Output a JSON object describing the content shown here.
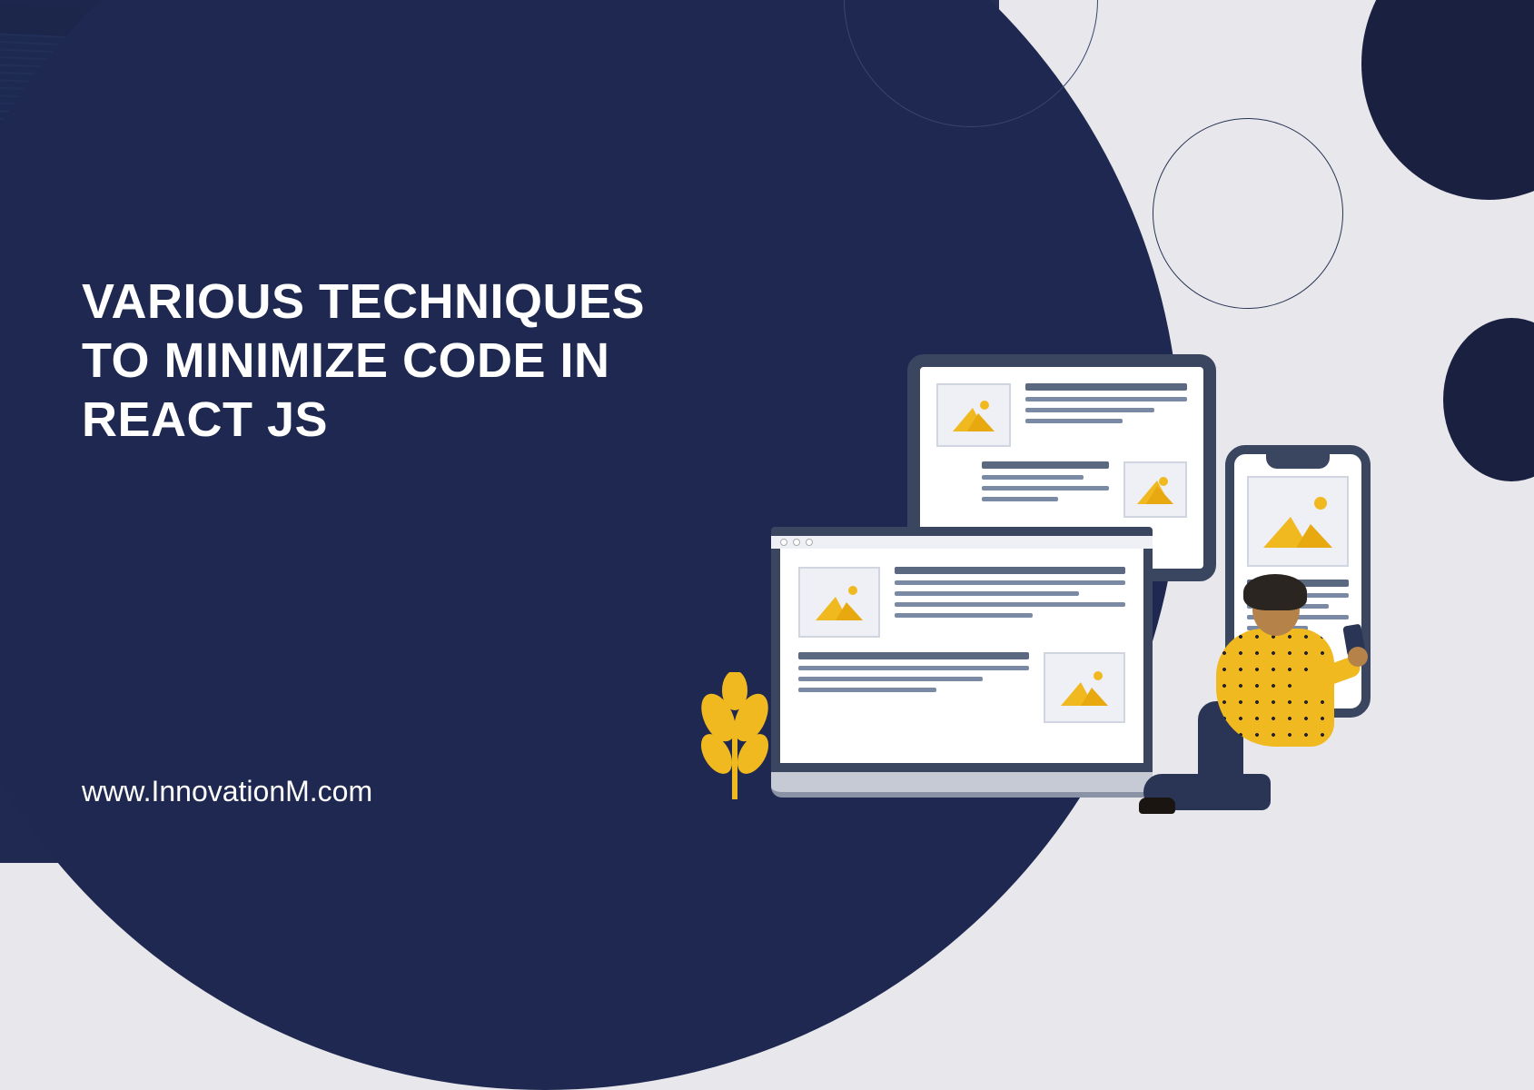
{
  "title": {
    "line1": "VARIOUS TECHNIQUES",
    "line2": "TO MINIMIZE CODE IN",
    "line3": "REACT JS"
  },
  "footer": {
    "url": "www.InnovationM.com"
  },
  "illustration": {
    "devices": [
      "tablet",
      "monitor",
      "phone"
    ],
    "person": "sitting-with-phone",
    "decoration": "yellow-leaf"
  }
}
